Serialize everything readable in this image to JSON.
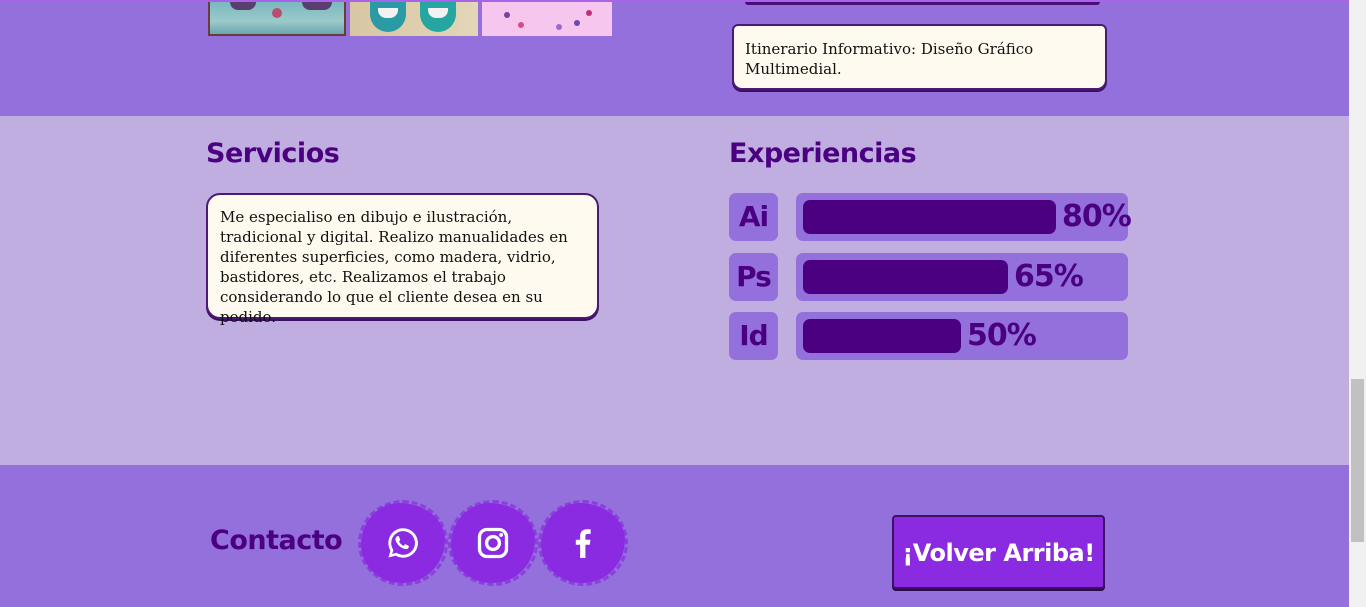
{
  "info": {
    "text": "Itinerario Informativo: Diseño Gráfico Multimedial."
  },
  "servicios": {
    "title": "Servicios",
    "text": "Me especialiso en dibujo e ilustración, tradicional y digital. Realizo manualidades en diferentes superficies, como madera, vidrio, bastidores, etc. Realizamos el trabajo considerando lo que el cliente desea en su pedido."
  },
  "experiencias": {
    "title": "Experiencias",
    "skills": [
      {
        "tag": "Ai",
        "percent_label": "80%",
        "value": 80
      },
      {
        "tag": "Ps",
        "percent_label": "65%",
        "value": 65
      },
      {
        "tag": "Id",
        "percent_label": "50%",
        "value": 50
      }
    ]
  },
  "footer": {
    "contact_title": "Contacto",
    "social": [
      "whatsapp-icon",
      "instagram-icon",
      "facebook-icon"
    ],
    "back_to_top_label": "¡Volver Arriba!"
  },
  "colors": {
    "accent": "#8a2be2",
    "dark_purple": "#4b0082",
    "band_purple": "#9370db",
    "mid_lavender": "#c0aee0",
    "card_bg": "#fffaf0"
  }
}
